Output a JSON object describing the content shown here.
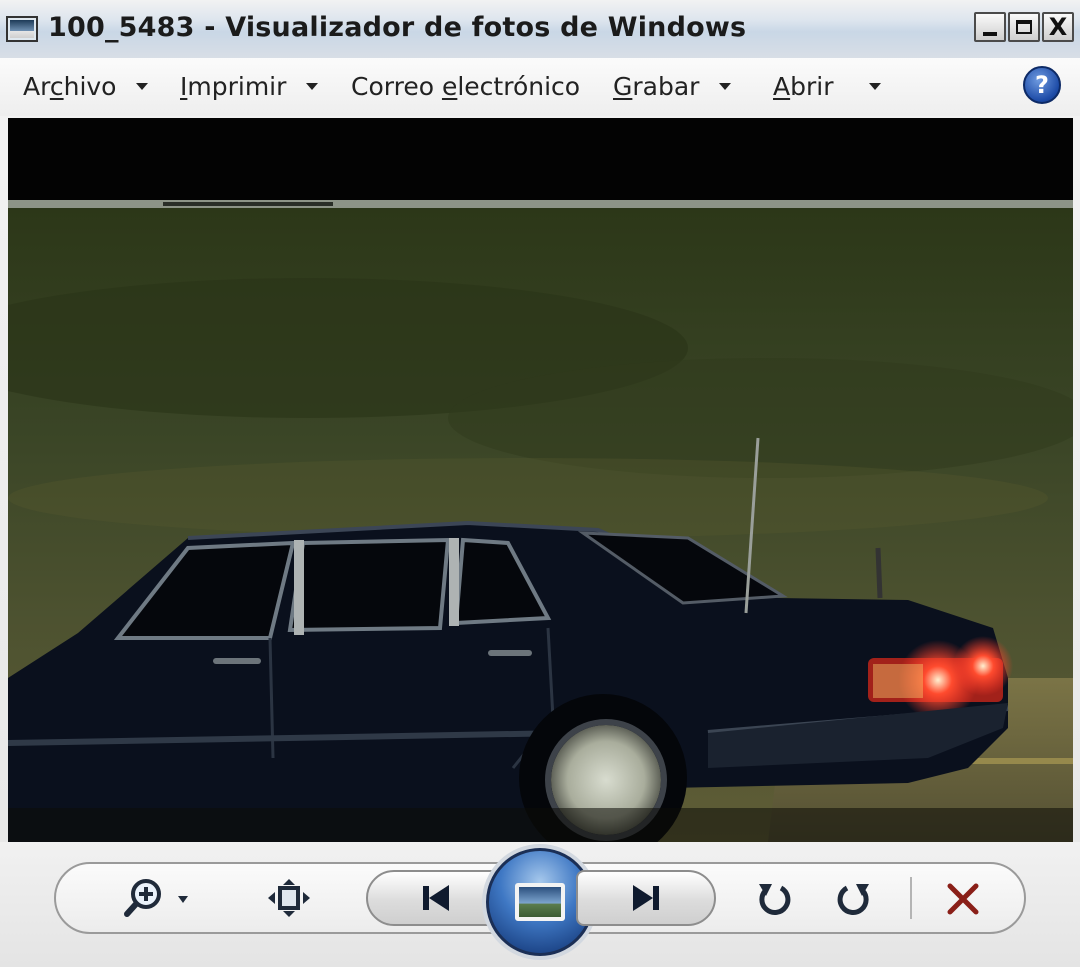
{
  "window": {
    "title": "100_5483 - Visualizador de fotos de Windows",
    "controls": {
      "minimize": "_",
      "maximize": "□",
      "close": "X"
    }
  },
  "menu": {
    "items": [
      {
        "label_pre": "Ar",
        "label_u": "c",
        "label_post": "hivo",
        "has_dropdown": true
      },
      {
        "label_pre": "",
        "label_u": "I",
        "label_post": "mprimir",
        "has_dropdown": true
      },
      {
        "label_pre": "Correo ",
        "label_u": "e",
        "label_post": "lectrónico",
        "has_dropdown": false
      },
      {
        "label_pre": "",
        "label_u": "G",
        "label_post": "rabar",
        "has_dropdown": true
      },
      {
        "label_pre": "",
        "label_u": "A",
        "label_post": "brir",
        "has_dropdown": true
      }
    ],
    "help": "?"
  },
  "photo": {
    "subject": "dark sedan driving at night",
    "colors": {
      "sky": "#2f3a1f",
      "road": "#6b6a3f",
      "car": "#0b1120",
      "taillight": "#ff3b2a"
    }
  },
  "toolbar": {
    "icons": [
      "zoom-icon",
      "actual-size-icon",
      "previous-icon",
      "slideshow-icon",
      "next-icon",
      "rotate-counterclockwise-icon",
      "rotate-clockwise-icon",
      "delete-icon"
    ],
    "delete_color": "#8a1f18"
  }
}
